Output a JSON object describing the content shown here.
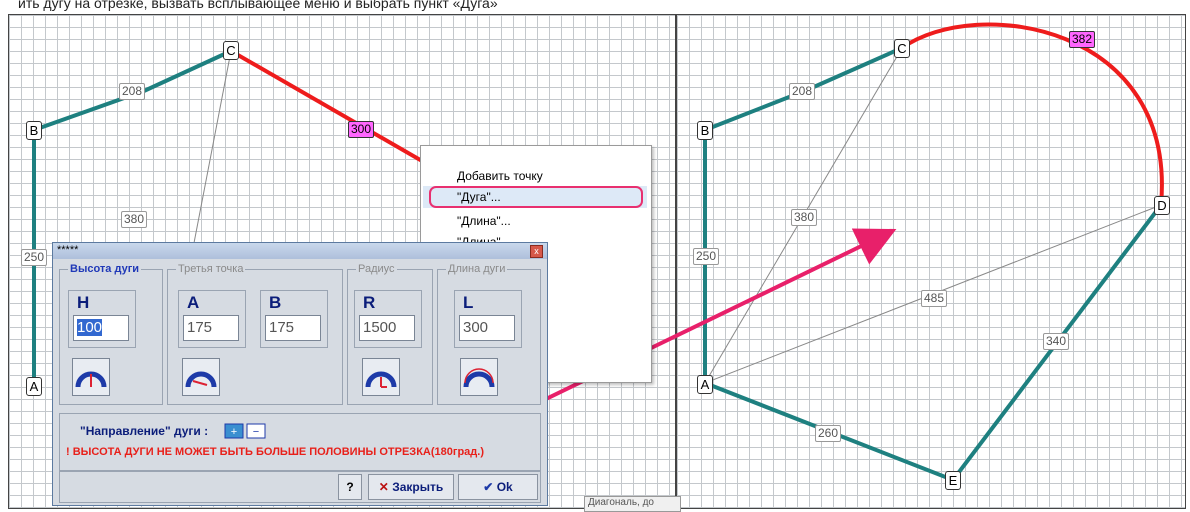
{
  "caption": "ить дугу на отрезке, вызвать всплывающее меню и выбрать пункт «Дуга»",
  "left_canvas": {
    "vertices": [
      "C",
      "B",
      "A"
    ],
    "edge_labels": {
      "bc": "208",
      "cd": "300",
      "ac": "380",
      "ab": "250"
    }
  },
  "right_canvas": {
    "vertices": [
      "C",
      "B",
      "D",
      "A",
      "E"
    ],
    "edge_labels": {
      "bc": "208",
      "cd": "382",
      "ac": "380",
      "ab": "250",
      "ad": "485",
      "de": "340",
      "ae": "260"
    }
  },
  "context_menu": {
    "items": [
      "Добавить точку",
      "\"Дуга\"...",
      "\"Длина\"...",
      "\"Длина\"..."
    ]
  },
  "dialog": {
    "title": "*****",
    "close": "x",
    "groups": {
      "height": {
        "title": "Высота дуги",
        "letter": "H",
        "value": "100"
      },
      "third_point": {
        "title": "Третья точка",
        "a_letter": "A",
        "a_value": "175",
        "b_letter": "B",
        "b_value": "175"
      },
      "radius": {
        "title": "Радиус",
        "letter": "R",
        "value": "1500"
      },
      "arc_length": {
        "title": "Длина дуги",
        "letter": "L",
        "value": "300"
      }
    },
    "direction_label": "\"Направление\" дуги :",
    "warning": "! ВЫСОТА ДУГИ НЕ МОЖЕТ БЫТЬ БОЛЬШЕ ПОЛОВИНЫ ОТРЕЗКА(180град.)",
    "help": "?",
    "close_button": "Закрыть",
    "ok_button": "Ok"
  },
  "status_text": "Диагональ, до",
  "colors": {
    "edge": "#1e8080",
    "selected_edge": "#ee1c1c",
    "arrow": "#e8206a",
    "selected_label": "#ff66ff"
  }
}
